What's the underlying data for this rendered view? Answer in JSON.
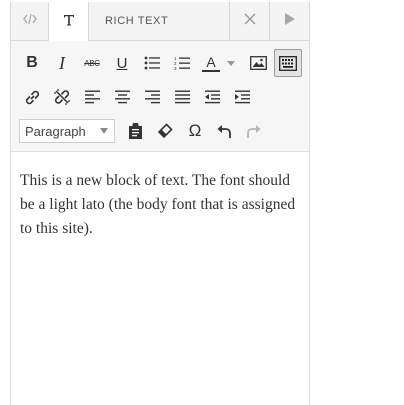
{
  "tabs": {
    "code_icon": "code-icon",
    "text_icon": "text-format-icon",
    "title": "RICH TEXT",
    "close_icon": "close-icon",
    "play_icon": "play-icon"
  },
  "toolbar": {
    "row1": [
      "bold",
      "italic",
      "strikethrough",
      "underline",
      "bullet-list",
      "numbered-list",
      "text-color",
      "insert-image",
      "toolbar-toggle"
    ],
    "row2": [
      "insert-link",
      "remove-link",
      "align-left",
      "align-center",
      "align-right",
      "justify",
      "outdent",
      "indent"
    ],
    "row3": [
      "paste-as-text",
      "clear-formatting",
      "special-character",
      "undo",
      "redo"
    ],
    "bold_label": "B",
    "italic_label": "I",
    "strike_label": "ABC",
    "underline_label": "U",
    "textcolor_label": "A",
    "omega_label": "Ω",
    "format_select": {
      "value": "Paragraph"
    }
  },
  "content": {
    "paragraph": "This is a new block of text. The font should be a light lato (the body font that is assigned to this site)."
  },
  "colors": {
    "toolbar_bg": "#f6f6f6",
    "tab_bg": "#f4f4f4",
    "text": "#333333"
  }
}
